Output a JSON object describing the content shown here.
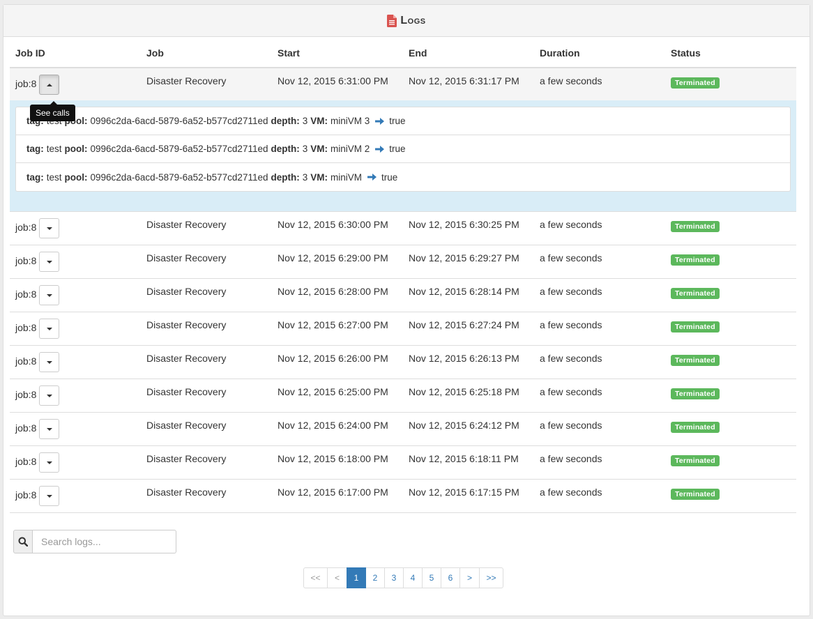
{
  "header": {
    "title": "Logs",
    "icon": "file-text-icon",
    "icon_color": "#d9534f"
  },
  "table": {
    "columns": [
      "Job ID",
      "Job",
      "Start",
      "End",
      "Duration",
      "Status"
    ],
    "expanded_row": {
      "job_id": "job:8",
      "job": "Disaster Recovery",
      "start": "Nov 12, 2015 6:31:00 PM",
      "end": "Nov 12, 2015 6:31:17 PM",
      "duration": "a few seconds",
      "status": "Terminated",
      "tooltip": "See calls",
      "calls": [
        {
          "tag_label": "tag:",
          "tag": "test",
          "pool_label": "pool:",
          "pool": "0996c2da-6acd-5879-6a52-b577cd2711ed",
          "depth_label": "depth:",
          "depth": "3",
          "vm_label": "VM:",
          "vm": "miniVM 3",
          "result": "true"
        },
        {
          "tag_label": "tag:",
          "tag": "test",
          "pool_label": "pool:",
          "pool": "0996c2da-6acd-5879-6a52-b577cd2711ed",
          "depth_label": "depth:",
          "depth": "3",
          "vm_label": "VM:",
          "vm": "miniVM 2",
          "result": "true"
        },
        {
          "tag_label": "tag:",
          "tag": "test",
          "pool_label": "pool:",
          "pool": "0996c2da-6acd-5879-6a52-b577cd2711ed",
          "depth_label": "depth:",
          "depth": "3",
          "vm_label": "VM:",
          "vm": "miniVM",
          "result": "true"
        }
      ]
    },
    "rows": [
      {
        "job_id": "job:8",
        "job": "Disaster Recovery",
        "start": "Nov 12, 2015 6:30:00 PM",
        "end": "Nov 12, 2015 6:30:25 PM",
        "duration": "a few seconds",
        "status": "Terminated"
      },
      {
        "job_id": "job:8",
        "job": "Disaster Recovery",
        "start": "Nov 12, 2015 6:29:00 PM",
        "end": "Nov 12, 2015 6:29:27 PM",
        "duration": "a few seconds",
        "status": "Terminated"
      },
      {
        "job_id": "job:8",
        "job": "Disaster Recovery",
        "start": "Nov 12, 2015 6:28:00 PM",
        "end": "Nov 12, 2015 6:28:14 PM",
        "duration": "a few seconds",
        "status": "Terminated"
      },
      {
        "job_id": "job:8",
        "job": "Disaster Recovery",
        "start": "Nov 12, 2015 6:27:00 PM",
        "end": "Nov 12, 2015 6:27:24 PM",
        "duration": "a few seconds",
        "status": "Terminated"
      },
      {
        "job_id": "job:8",
        "job": "Disaster Recovery",
        "start": "Nov 12, 2015 6:26:00 PM",
        "end": "Nov 12, 2015 6:26:13 PM",
        "duration": "a few seconds",
        "status": "Terminated"
      },
      {
        "job_id": "job:8",
        "job": "Disaster Recovery",
        "start": "Nov 12, 2015 6:25:00 PM",
        "end": "Nov 12, 2015 6:25:18 PM",
        "duration": "a few seconds",
        "status": "Terminated"
      },
      {
        "job_id": "job:8",
        "job": "Disaster Recovery",
        "start": "Nov 12, 2015 6:24:00 PM",
        "end": "Nov 12, 2015 6:24:12 PM",
        "duration": "a few seconds",
        "status": "Terminated"
      },
      {
        "job_id": "job:8",
        "job": "Disaster Recovery",
        "start": "Nov 12, 2015 6:18:00 PM",
        "end": "Nov 12, 2015 6:18:11 PM",
        "duration": "a few seconds",
        "status": "Terminated"
      },
      {
        "job_id": "job:8",
        "job": "Disaster Recovery",
        "start": "Nov 12, 2015 6:17:00 PM",
        "end": "Nov 12, 2015 6:17:15 PM",
        "duration": "a few seconds",
        "status": "Terminated"
      }
    ]
  },
  "search": {
    "placeholder": "Search logs...",
    "value": "",
    "icon": "search-icon"
  },
  "pagination": {
    "items": [
      "<<",
      "<",
      "1",
      "2",
      "3",
      "4",
      "5",
      "6",
      ">",
      ">>"
    ],
    "current": "1"
  },
  "colors": {
    "status_success": "#5cb85c",
    "accent": "#337ab7",
    "details_bg": "#d9edf7"
  }
}
